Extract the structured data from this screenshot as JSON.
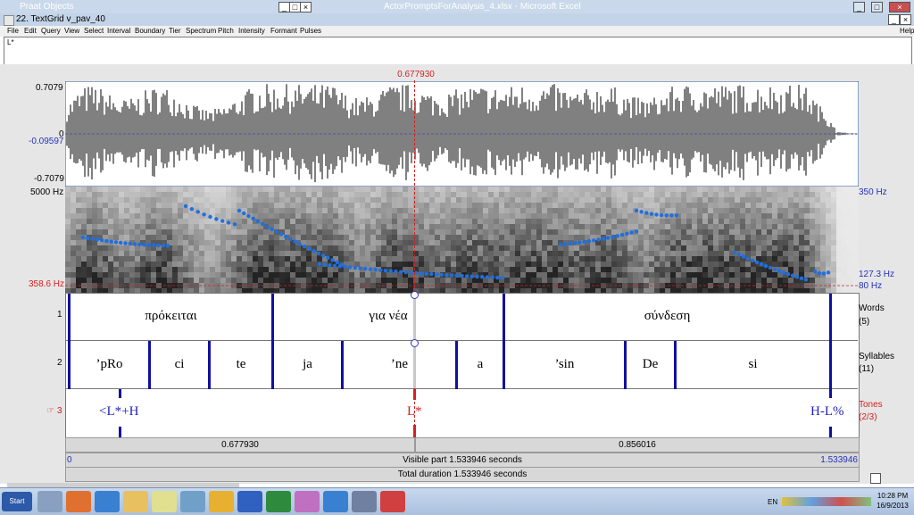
{
  "background_windows": {
    "praat_objects_title": "Praat Objects",
    "excel_title": "ActorPromptsForAnalysis_4.xlsx - Microsoft Excel"
  },
  "window": {
    "title": "22. TextGrid v_pav_40",
    "help_label": "Help"
  },
  "menu": [
    "File",
    "Edit",
    "Query",
    "View",
    "Select",
    "Interval",
    "Boundary",
    "Tier",
    "Spectrum",
    "Pitch",
    "Intensity",
    "Formant",
    "Pulses"
  ],
  "text_field": {
    "value": "L*"
  },
  "cursor": {
    "time": "0.677930",
    "time_value": 0.67793
  },
  "waveform": {
    "top_value": "0.7079",
    "zero_label": "0",
    "cursor_value": "-0.09597",
    "bottom_value": "-0.7079"
  },
  "spectrogram": {
    "top_freq": "5000 Hz",
    "cursor_freq": "358.6 Hz",
    "pitch_top": "350 Hz",
    "pitch_cursor": "127.3 Hz",
    "pitch_bottom": "80 Hz"
  },
  "tiers": [
    {
      "number": "1",
      "name": "Words",
      "count": "(5)",
      "intervals": [
        {
          "text": "πρόκειται",
          "start": 0.0,
          "end": 0.53
        },
        {
          "text": "για νέα",
          "start": 0.53,
          "end": 0.98
        },
        {
          "text": "σύνδεση",
          "start": 0.98,
          "end": 1.5
        }
      ]
    },
    {
      "number": "2",
      "name": "Syllables",
      "count": "(11)",
      "intervals": [
        {
          "text": "’pRo",
          "start": 0.0,
          "end": 0.16
        },
        {
          "text": "ci",
          "start": 0.16,
          "end": 0.28
        },
        {
          "text": "te",
          "start": 0.28,
          "end": 0.53
        },
        {
          "text": "ja",
          "start": 0.53,
          "end": 0.67
        },
        {
          "text": "’ne",
          "start": 0.67,
          "end": 0.79
        },
        {
          "text": "a",
          "start": 0.79,
          "end": 0.98
        },
        {
          "text": "’sin",
          "start": 0.98,
          "end": 1.12
        },
        {
          "text": "De",
          "start": 1.12,
          "end": 1.26
        },
        {
          "text": "si",
          "start": 1.26,
          "end": 1.5
        }
      ]
    },
    {
      "number": "3",
      "name": "Tones",
      "count": "(2/3)",
      "points": [
        {
          "text": "<L*+H",
          "time": 0.1
        },
        {
          "text": "L*",
          "time": 0.6779
        },
        {
          "text": "H-L%",
          "time": 1.5
        }
      ]
    }
  ],
  "selection": {
    "left_duration": "0.677930",
    "right_duration": "0.856016",
    "start": "0",
    "end": "1.533946",
    "visible_part": "Visible part 1.533946 seconds",
    "total_duration": "Total duration 1.533946 seconds"
  },
  "colors": {
    "cursor": "#d42020",
    "boundary": "#1010a0",
    "pitch": "#1f6fe0",
    "pitch_labels": "#2233bb",
    "tone_selected": "#d42020"
  },
  "taskbar": {
    "start_label": "Start",
    "language": "EN",
    "time": "10:28 PM",
    "date": "16/9/2013"
  }
}
